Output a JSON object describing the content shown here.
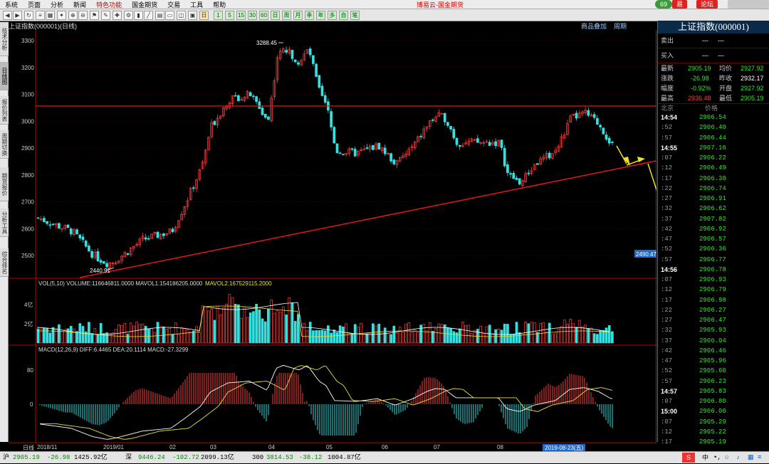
{
  "menu": {
    "items": [
      "系统",
      "页面",
      "分析",
      "新闻",
      "特色功能",
      "国金期货",
      "交易",
      "工具",
      "帮助"
    ],
    "brand": "博易云-国金期货",
    "badge": "69",
    "btn_easy": "易",
    "btn_forum": "论坛"
  },
  "chart_header": {
    "title": "上证指数(000001)(日线)",
    "link_goods": "商品叠加",
    "link_period": "周期"
  },
  "side_tabs": [
    "技术分析",
    "日线图",
    "报价列表",
    "周期切换",
    "期货报价",
    "分析工具",
    "综合排名"
  ],
  "main_chart": {
    "annotations": {
      "high": "3288.45",
      "low": "2440.91",
      "price_tag": "2490.47"
    },
    "y_ticks": [
      "3300",
      "3200",
      "3100",
      "3000",
      "2900",
      "2800",
      "2700",
      "2600",
      "2500"
    ],
    "x_labels": [
      "2018/11",
      "2019/01",
      "02",
      "03",
      "04",
      "05",
      "06",
      "07",
      "08"
    ],
    "date_badge": "2019-08-23(五)",
    "day_label": "日线"
  },
  "vol_panel": {
    "title": "VOL(5,10) VOLUME:116646811.0000 MAVOL1:154186205.0000",
    "mavol2": "MAVOL2:167529115.2000",
    "y_ticks": [
      "4亿",
      "2亿"
    ]
  },
  "macd_panel": {
    "title": "MACD(12,26,9) DIFF:6.4465 DEA:20.1114 MACD:-27.3299",
    "y_ticks": [
      "80",
      "0"
    ]
  },
  "quote": {
    "title": "上证指数(000001)",
    "sell": {
      "label": "卖出",
      "v1": "---",
      "v2": "---"
    },
    "buy": {
      "label": "买入",
      "v1": "---",
      "v2": "---"
    },
    "rows": [
      {
        "l1": "最新",
        "v1": "2905.19",
        "l2": "均价",
        "v2": "2927.92"
      },
      {
        "l1": "涨跌",
        "v1": "-26.98",
        "l2": "昨收",
        "v2": "2932.17"
      },
      {
        "l1": "幅度",
        "v1": "-0.92%",
        "l2": "开盘",
        "v2": "2927.92"
      },
      {
        "l1": "最高",
        "v1": "2936.48",
        "l2": "最低",
        "v2": "2905.19"
      }
    ],
    "tick_header": {
      "city": "北京",
      "price": "价格"
    },
    "ticks": [
      [
        "14:54",
        "2906.54"
      ],
      [
        ":52",
        "2906.40"
      ],
      [
        ":57",
        "2906.44"
      ],
      [
        "14:55",
        "2907.16"
      ],
      [
        ":07",
        "2906.22"
      ],
      [
        ":12",
        "2906.49"
      ],
      [
        ":17",
        "2906.38"
      ],
      [
        ":22",
        "2906.74"
      ],
      [
        ":27",
        "2906.91"
      ],
      [
        ":32",
        "2906.62"
      ],
      [
        ":37",
        "2907.82"
      ],
      [
        ":42",
        "2906.92"
      ],
      [
        ":47",
        "2906.57"
      ],
      [
        ":52",
        "2906.36"
      ],
      [
        ":57",
        "2906.77"
      ],
      [
        "14:56",
        "2906.78"
      ],
      [
        ":07",
        "2906.93"
      ],
      [
        ":12",
        "2906.79"
      ],
      [
        ":17",
        "2906.98"
      ],
      [
        ":22",
        "2906.27"
      ],
      [
        ":27",
        "2906.47"
      ],
      [
        ":32",
        "2905.93"
      ],
      [
        ":37",
        "2906.04"
      ],
      [
        ":42",
        "2906.46"
      ],
      [
        ":47",
        "2905.96"
      ],
      [
        ":52",
        "2905.60"
      ],
      [
        ":57",
        "2906.23"
      ],
      [
        "14:57",
        "2905.83"
      ],
      [
        ":07",
        "2906.80"
      ],
      [
        "15:00",
        "2906.00"
      ],
      [
        ":07",
        "2905.29"
      ],
      [
        ":12",
        "2905.22"
      ],
      [
        ":17",
        "2905.19"
      ]
    ]
  },
  "status": {
    "sh_label": "沪",
    "sh_price": "2905.19",
    "sh_chg": "-26.98",
    "sh_amt": "1425.92亿",
    "sz_label": "深",
    "sz_price": "9446.24",
    "sz_chg": "-102.72",
    "sz_amt": "2099.13亿",
    "c300_label": "300",
    "c300_price": "3814.53",
    "c300_chg": "-38.12",
    "c300_amt": "1004.87亿"
  },
  "ime": {
    "lang": "中",
    "punct": "•,"
  },
  "colors": {
    "up": "#ff3c3c",
    "down": "#35e0e0",
    "trendline": "#e01818",
    "arrow": "#f0e020",
    "dif": "#ffffff",
    "dea": "#e8e040"
  }
}
